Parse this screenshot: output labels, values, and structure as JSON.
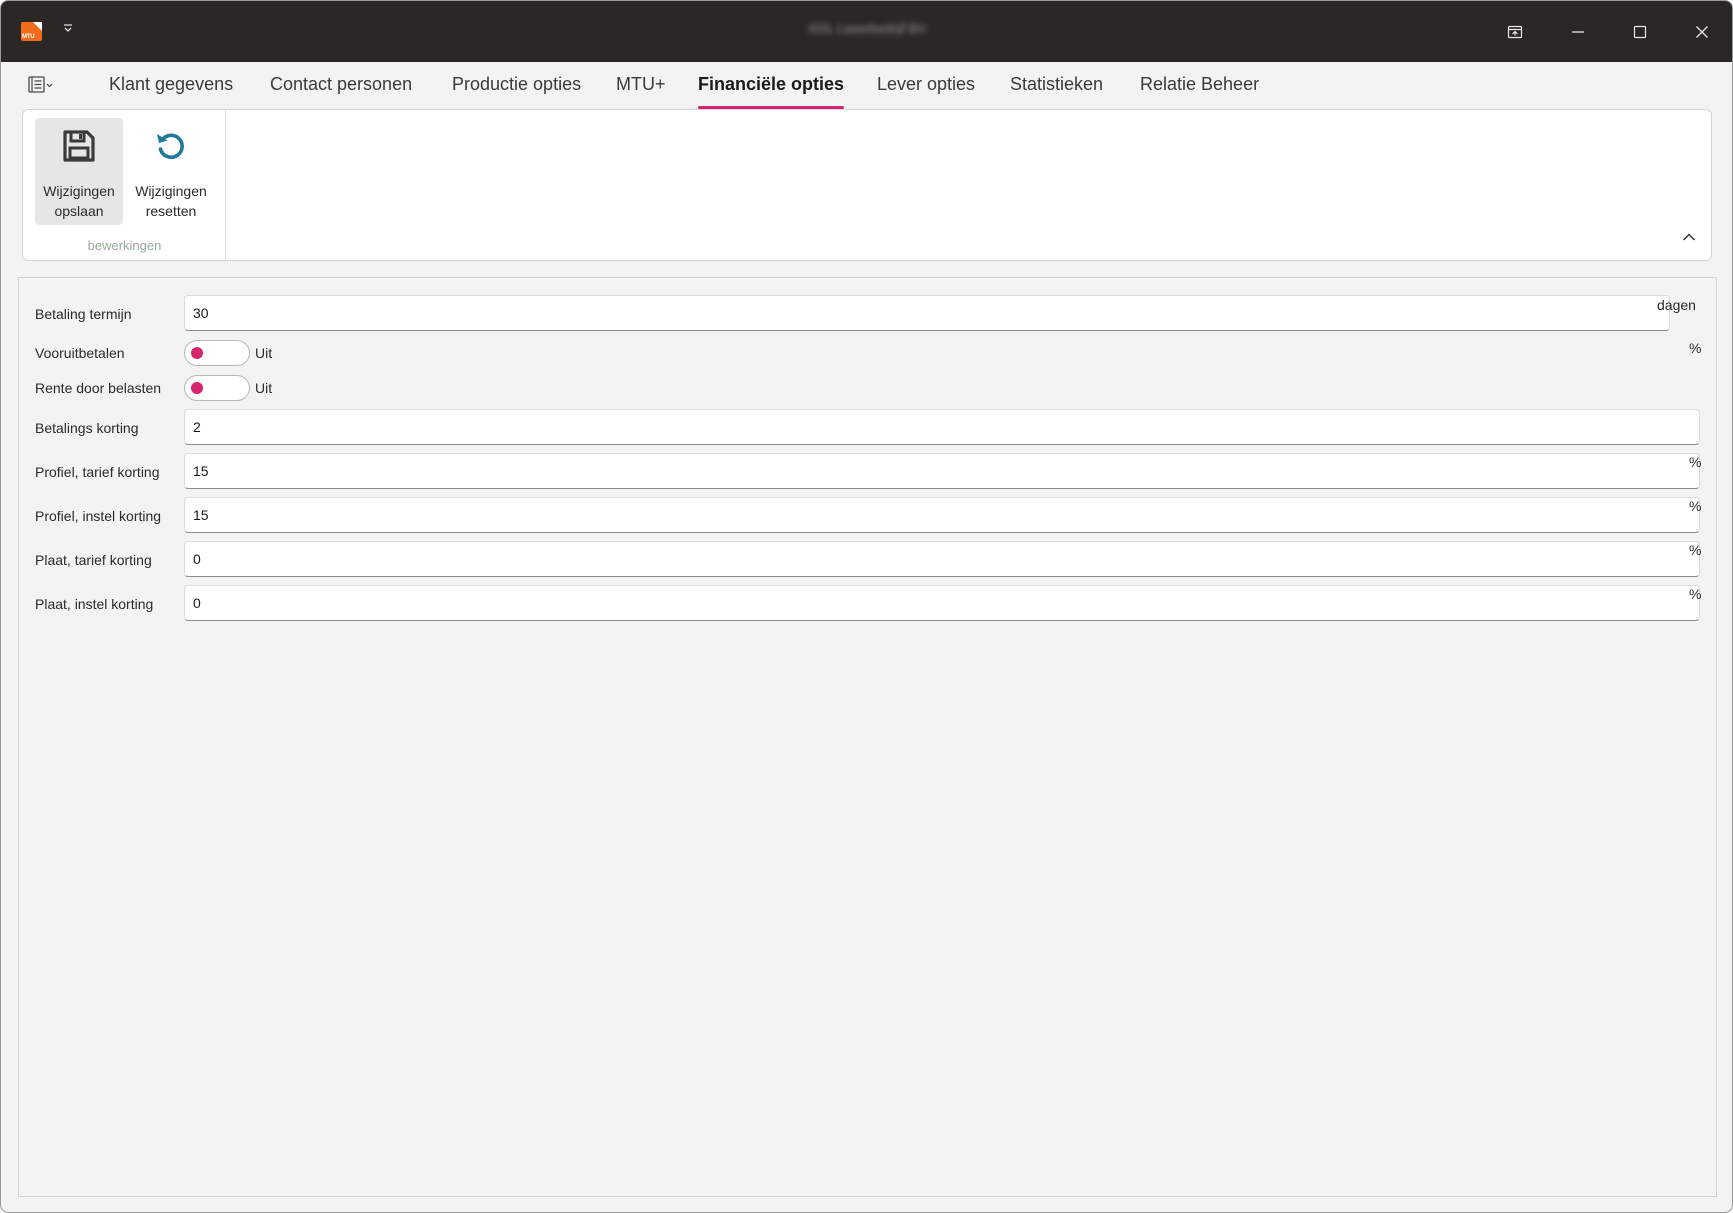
{
  "titlebar": {
    "logo_text": "MTU",
    "window_title": "KDL Laserbedrijf BV",
    "icons": [
      "restore-panel-icon",
      "minimize-icon",
      "maximize-icon",
      "close-icon"
    ]
  },
  "tabs": [
    {
      "label": "Klant gegevens",
      "active": false
    },
    {
      "label": "Contact personen",
      "active": false
    },
    {
      "label": "Productie opties",
      "active": false
    },
    {
      "label": "MTU+",
      "active": false
    },
    {
      "label": "Financiële opties",
      "active": true
    },
    {
      "label": "Lever opties",
      "active": false
    },
    {
      "label": "Statistieken",
      "active": false
    },
    {
      "label": "Relatie Beheer",
      "active": false
    }
  ],
  "ribbon": {
    "save_label_line1": "Wijzigingen",
    "save_label_line2": "opslaan",
    "reset_label_line1": "Wijzigingen",
    "reset_label_line2": "resetten",
    "group_label": "bewerkingen"
  },
  "form": {
    "betaling_termijn": {
      "label": "Betaling termijn",
      "value": "30",
      "unit": "dagen"
    },
    "vooruitbetalen": {
      "label": "Vooruitbetalen",
      "state": "Uit",
      "unit": "%"
    },
    "rente_door_belasten": {
      "label": "Rente door belasten",
      "state": "Uit"
    },
    "betalings_korting": {
      "label": "Betalings korting",
      "value": "2"
    },
    "profiel_tarief_korting": {
      "label": "Profiel, tarief korting",
      "value": "15",
      "unit": "%"
    },
    "profiel_instel_korting": {
      "label": "Profiel, instel korting",
      "value": "15",
      "unit": "%"
    },
    "plaat_tarief_korting": {
      "label": "Plaat, tarief korting",
      "value": "0",
      "unit": "%"
    },
    "plaat_instel_korting": {
      "label": "Plaat, instel korting",
      "value": "0",
      "unit": "%"
    }
  },
  "colors": {
    "accent": "#d6246e",
    "titlebar": "#2b2725",
    "logo": "#f26b1d",
    "reset_icon": "#1f7a99"
  }
}
